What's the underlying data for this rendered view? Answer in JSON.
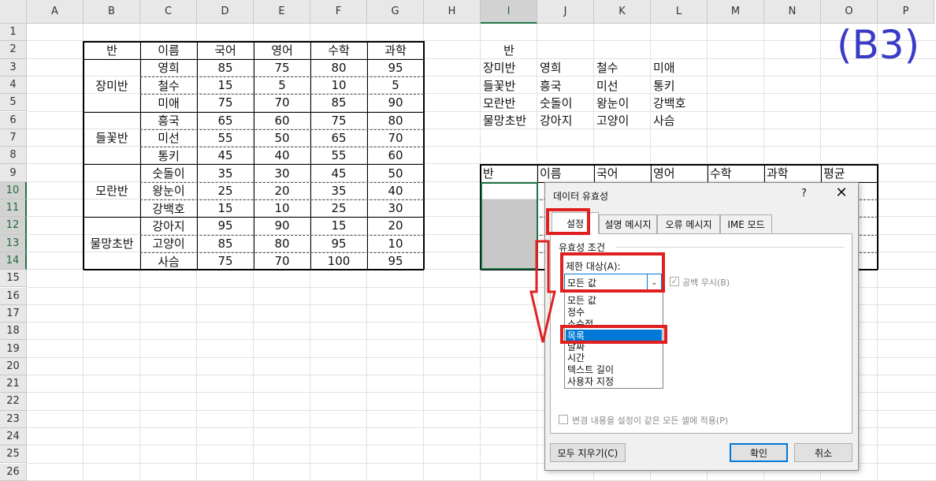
{
  "sheet": {
    "columns": [
      "A",
      "B",
      "C",
      "D",
      "E",
      "F",
      "G",
      "H",
      "I",
      "J",
      "K",
      "L",
      "M",
      "N",
      "O",
      "P"
    ],
    "rows": [
      "1",
      "2",
      "3",
      "4",
      "5",
      "6",
      "7",
      "8",
      "9",
      "10",
      "11",
      "12",
      "13",
      "14",
      "15",
      "16",
      "17",
      "18",
      "19",
      "20",
      "21",
      "22",
      "23",
      "24",
      "25",
      "26"
    ],
    "selected_column": "I",
    "selected_rows": [
      "10",
      "11",
      "12",
      "13",
      "14"
    ]
  },
  "score_table": {
    "headers": [
      "반",
      "이름",
      "국어",
      "영어",
      "수학",
      "과학"
    ],
    "groups": [
      {
        "name": "장미반",
        "students": [
          {
            "name": "영희",
            "scores": [
              "85",
              "75",
              "80",
              "95"
            ]
          },
          {
            "name": "철수",
            "scores": [
              "15",
              "5",
              "10",
              "5"
            ]
          },
          {
            "name": "미애",
            "scores": [
              "75",
              "70",
              "85",
              "90"
            ]
          }
        ]
      },
      {
        "name": "들꽃반",
        "students": [
          {
            "name": "흥국",
            "scores": [
              "65",
              "60",
              "75",
              "80"
            ]
          },
          {
            "name": "미선",
            "scores": [
              "55",
              "50",
              "65",
              "70"
            ]
          },
          {
            "name": "통키",
            "scores": [
              "45",
              "40",
              "55",
              "60"
            ]
          }
        ]
      },
      {
        "name": "모란반",
        "students": [
          {
            "name": "숫돌이",
            "scores": [
              "35",
              "30",
              "45",
              "50"
            ]
          },
          {
            "name": "왕눈이",
            "scores": [
              "25",
              "20",
              "35",
              "40"
            ]
          },
          {
            "name": "강백호",
            "scores": [
              "15",
              "10",
              "25",
              "30"
            ]
          }
        ]
      },
      {
        "name": "물망초반",
        "students": [
          {
            "name": "강아지",
            "scores": [
              "95",
              "90",
              "15",
              "20"
            ]
          },
          {
            "name": "고양이",
            "scores": [
              "85",
              "80",
              "95",
              "10"
            ]
          },
          {
            "name": "사슴",
            "scores": [
              "75",
              "70",
              "100",
              "95"
            ]
          }
        ]
      }
    ]
  },
  "lookup": {
    "header": "반",
    "rows": [
      [
        "장미반",
        "영희",
        "철수",
        "미애"
      ],
      [
        "들꽃반",
        "흥국",
        "미선",
        "통키"
      ],
      [
        "모란반",
        "숫돌이",
        "왕눈이",
        "강백호"
      ],
      [
        "물망초반",
        "강아지",
        "고양이",
        "사슴"
      ]
    ]
  },
  "result_table": {
    "headers": [
      "반",
      "이름",
      "국어",
      "영어",
      "수학",
      "과학",
      "평균"
    ]
  },
  "overlay_label": "(B3)",
  "dialog": {
    "title": "데이터 유효성",
    "help": "?",
    "close": "✕",
    "tabs": [
      "설정",
      "설명 메시지",
      "오류 메시지",
      "IME 모드"
    ],
    "active_tab": "설정",
    "group_label": "유효성 조건",
    "allow_label": "제한 대상(A):",
    "allow_value": "모든 값",
    "ignore_blank_label": "공백 무시(B)",
    "ignore_blank_checked": true,
    "options": [
      "모든 값",
      "정수",
      "소수점",
      "목록",
      "날짜",
      "시간",
      "텍스트 길이",
      "사용자 지정"
    ],
    "selected_option": "목록",
    "apply_all_label": "변경 내용을 설정이 같은 모든 셀에 적용(P)",
    "clear_button": "모두 지우기(C)",
    "ok_button": "확인",
    "cancel_button": "취소"
  },
  "colors": {
    "excel_green": "#217346",
    "annotation_red": "#e02020",
    "label_blue": "#3a3ac8",
    "list_highlight": "#0078d7"
  }
}
